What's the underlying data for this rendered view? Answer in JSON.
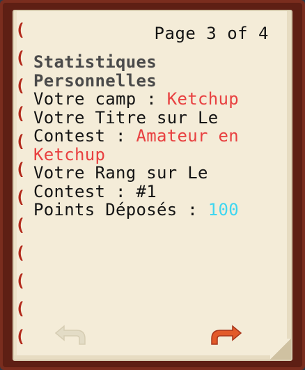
{
  "book": {
    "page_indicator": "Page 3 of 4",
    "title_line1": "Statistiques",
    "title_line2": "Personnelles",
    "camp_label": "Votre camp : ",
    "camp_value": "Ketchup",
    "titre_label_line1": "Votre Titre sur Le",
    "titre_label_line2": "Contest : ",
    "titre_value_part1": "Amateur en",
    "titre_value_part2": "Ketchup",
    "rang_line1": "Votre Rang sur Le",
    "rang_line2": "Contest : #1",
    "points_label": "Points Déposés : ",
    "points_value": "100"
  },
  "colors": {
    "highlight_red": "#e84040",
    "highlight_cyan": "#3fd6f0",
    "title_gray": "#4a4a4a",
    "arrow_orange": "#e25a2a",
    "arrow_disabled": "#e3dcc6"
  },
  "icons": {
    "prev": "arrow-back-icon",
    "next": "arrow-forward-icon"
  }
}
